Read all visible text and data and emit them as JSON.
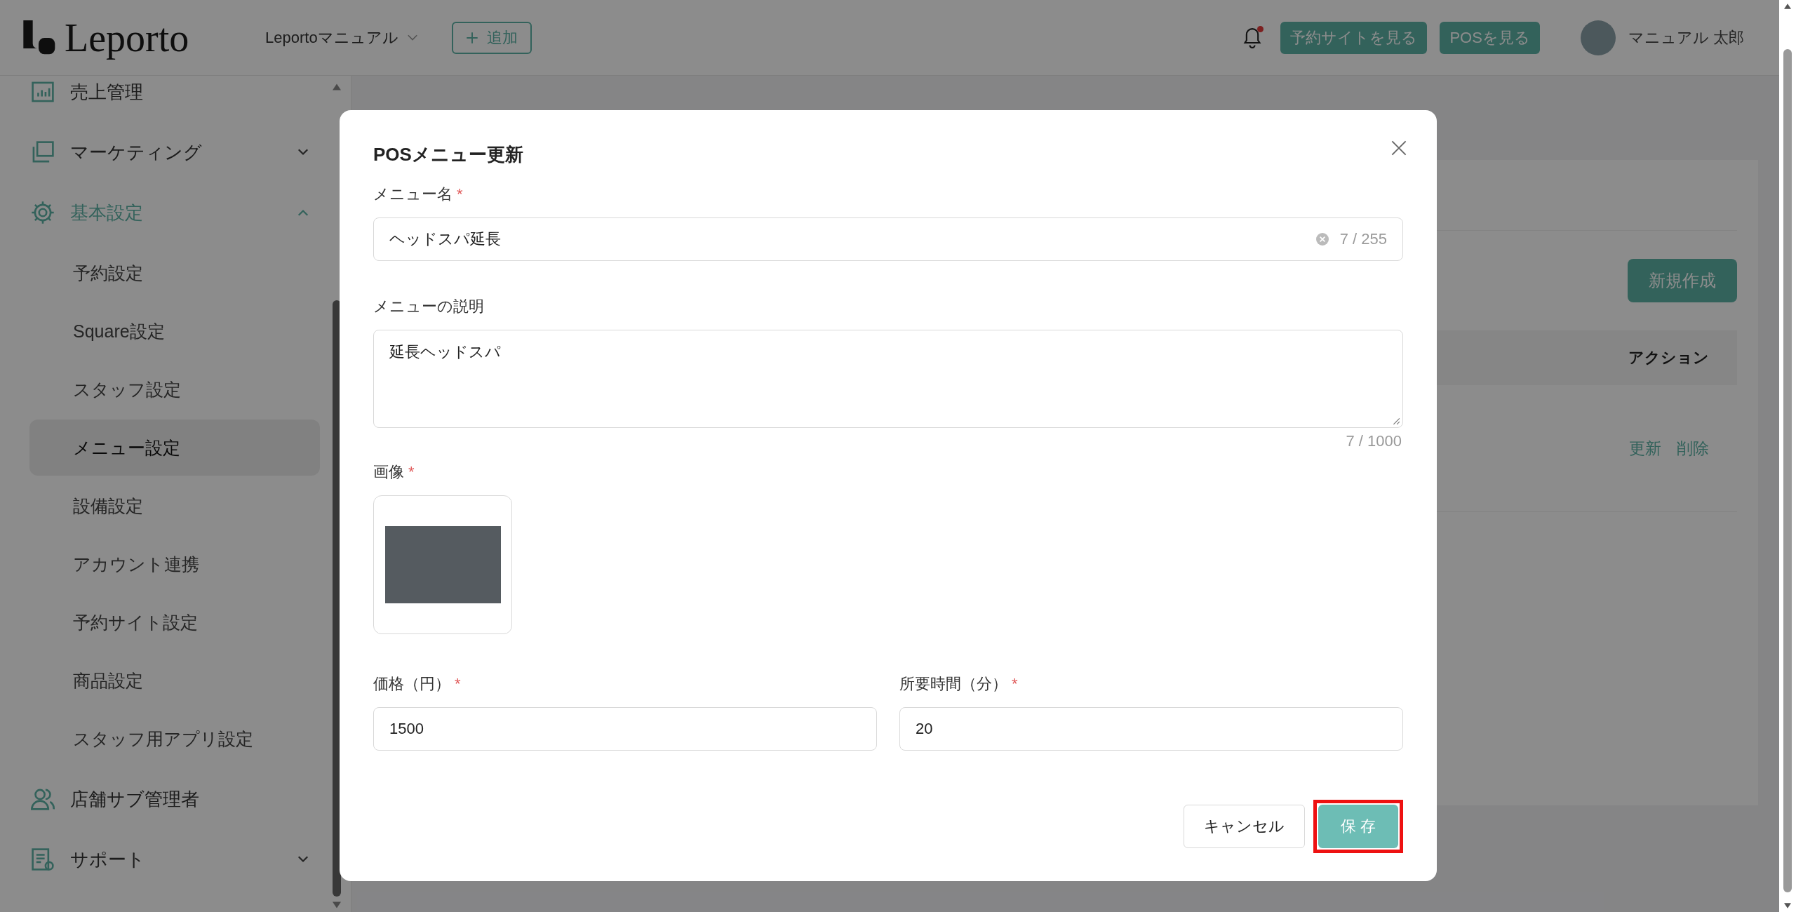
{
  "header": {
    "logo": "Leporto",
    "store_selector": "Leportoマニュアル",
    "add_button": "追加",
    "notification_unread": true,
    "buttons": [
      "予約サイトを見る",
      "POSを見る"
    ],
    "user_name": "マニュアル 太郎"
  },
  "sidebar": {
    "items": [
      {
        "label": "売上管理",
        "kind": "link",
        "active": false
      },
      {
        "label": "マーケティング",
        "kind": "group",
        "active": false,
        "expanded": false
      },
      {
        "label": "基本設定",
        "kind": "group",
        "active": true,
        "expanded": true,
        "children": [
          {
            "label": "予約設定",
            "selected": false
          },
          {
            "label": "Square設定",
            "selected": false
          },
          {
            "label": "スタッフ設定",
            "selected": false
          },
          {
            "label": "メニュー設定",
            "selected": true
          },
          {
            "label": "設備設定",
            "selected": false
          },
          {
            "label": "アカウント連携",
            "selected": false
          },
          {
            "label": "予約サイト設定",
            "selected": false
          },
          {
            "label": "商品設定",
            "selected": false
          },
          {
            "label": "スタッフ用アプリ設定",
            "selected": false
          }
        ]
      },
      {
        "label": "店舗サブ管理者",
        "kind": "link",
        "active": false
      },
      {
        "label": "サポート",
        "kind": "group",
        "active": false,
        "expanded": false
      }
    ]
  },
  "page": {
    "new_button": "新規作成",
    "table": {
      "columns": [
        "アクション"
      ],
      "rows": [
        {
          "actions": [
            "更新",
            "削除"
          ]
        }
      ]
    }
  },
  "dialog": {
    "title": "POSメニュー更新",
    "name_field": {
      "label": "メニュー名",
      "required_mark": "*",
      "value": "ヘッドスパ延長",
      "count": "7 / 255"
    },
    "description_field": {
      "label": "メニューの説明",
      "value": "延長ヘッドスパ",
      "count": "7 / 1000"
    },
    "image_field": {
      "label": "画像",
      "required_mark": "*"
    },
    "price_field": {
      "label": "価格（円）",
      "required_mark": "*",
      "value": "1500"
    },
    "duration_field": {
      "label": "所要時間（分）",
      "required_mark": "*",
      "value": "20"
    },
    "buttons": [
      {
        "label": "キャンセル",
        "kind": "secondary",
        "highlighted": false
      },
      {
        "label": "保 存",
        "kind": "primary",
        "highlighted": true
      }
    ]
  }
}
